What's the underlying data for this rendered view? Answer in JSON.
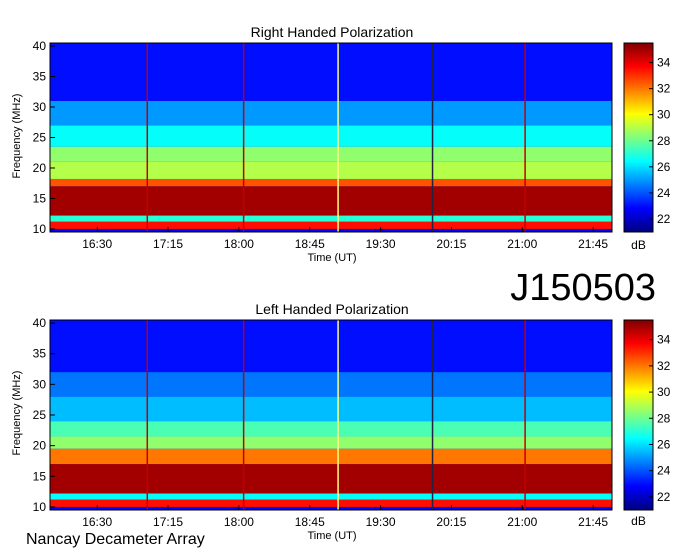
{
  "source_label": "Nancay Decameter Array",
  "observation_id": "J150503",
  "colors": {
    "background": "#ffffff",
    "colormap": [
      "#00007f",
      "#0000ff",
      "#007fff",
      "#00ffff",
      "#7fff7f",
      "#ffff00",
      "#ff7f00",
      "#ff0000",
      "#7f0000"
    ]
  },
  "chart_data": [
    {
      "type": "heatmap",
      "title": "Right Handed Polarization",
      "xlabel": "Time (UT)",
      "ylabel": "Frequency (MHz)",
      "x_ticks": [
        "16:30",
        "17:15",
        "18:00",
        "18:45",
        "19:30",
        "20:15",
        "21:00",
        "21:45"
      ],
      "x_tick_hours": [
        16.5,
        17.25,
        18.0,
        18.75,
        19.5,
        20.25,
        21.0,
        21.75
      ],
      "xlim_hours": [
        16.0,
        21.95
      ],
      "ylim": [
        9.5,
        40.5
      ],
      "y_ticks": [
        10,
        15,
        20,
        25,
        30,
        35,
        40
      ],
      "colorbar": {
        "label": "dB",
        "range": [
          21,
          35.5
        ],
        "ticks": [
          22,
          24,
          26,
          28,
          30,
          32,
          34
        ]
      },
      "vertical_lines": [
        {
          "time_h": 17.03,
          "color": "#c00000"
        },
        {
          "time_h": 18.05,
          "color": "#c00000"
        },
        {
          "time_h": 19.05,
          "color": "#ffff80"
        },
        {
          "time_h": 20.05,
          "color": "#222244"
        },
        {
          "time_h": 21.03,
          "color": "#c00000"
        }
      ],
      "bands": [
        {
          "fmin": 10.0,
          "fmax": 11.2,
          "level": 33.5
        },
        {
          "fmin": 11.2,
          "fmax": 12.2,
          "level": 27.0
        },
        {
          "fmin": 12.2,
          "fmax": 17.0,
          "level": 35.0
        },
        {
          "fmin": 17.0,
          "fmax": 18.2,
          "level": 32.5
        },
        {
          "fmin": 18.2,
          "fmax": 21.0,
          "level": 29.0
        },
        {
          "fmin": 21.0,
          "fmax": 23.5,
          "level": 28.5
        },
        {
          "fmin": 23.5,
          "fmax": 27.0,
          "level": 26.5
        },
        {
          "fmin": 27.0,
          "fmax": 31.0,
          "level": 25.0
        },
        {
          "fmin": 31.0,
          "fmax": 40.5,
          "level": 23.0
        }
      ]
    },
    {
      "type": "heatmap",
      "title": "Left Handed Polarization",
      "xlabel": "Time (UT)",
      "ylabel": "Frequency (MHz)",
      "x_ticks": [
        "16:30",
        "17:15",
        "18:00",
        "18:45",
        "19:30",
        "20:15",
        "21:00",
        "21:45"
      ],
      "x_tick_hours": [
        16.5,
        17.25,
        18.0,
        18.75,
        19.5,
        20.25,
        21.0,
        21.75
      ],
      "xlim_hours": [
        16.0,
        21.95
      ],
      "ylim": [
        9.5,
        40.5
      ],
      "y_ticks": [
        10,
        15,
        20,
        25,
        30,
        35,
        40
      ],
      "colorbar": {
        "label": "dB",
        "range": [
          21,
          35.5
        ],
        "ticks": [
          22,
          24,
          26,
          28,
          30,
          32,
          34
        ]
      },
      "vertical_lines": [
        {
          "time_h": 17.03,
          "color": "#c00000"
        },
        {
          "time_h": 18.05,
          "color": "#c00000"
        },
        {
          "time_h": 19.05,
          "color": "#ffff80"
        },
        {
          "time_h": 20.05,
          "color": "#222244"
        },
        {
          "time_h": 21.03,
          "color": "#c00000"
        }
      ],
      "bands": [
        {
          "fmin": 10.0,
          "fmax": 11.2,
          "level": 33.5
        },
        {
          "fmin": 11.2,
          "fmax": 12.2,
          "level": 26.5
        },
        {
          "fmin": 12.2,
          "fmax": 17.0,
          "level": 35.0
        },
        {
          "fmin": 17.0,
          "fmax": 19.5,
          "level": 32.0
        },
        {
          "fmin": 19.5,
          "fmax": 21.5,
          "level": 28.5
        },
        {
          "fmin": 21.5,
          "fmax": 24.0,
          "level": 27.5
        },
        {
          "fmin": 24.0,
          "fmax": 28.0,
          "level": 25.5
        },
        {
          "fmin": 28.0,
          "fmax": 32.0,
          "level": 24.5
        },
        {
          "fmin": 32.0,
          "fmax": 40.5,
          "level": 23.0
        }
      ]
    }
  ]
}
